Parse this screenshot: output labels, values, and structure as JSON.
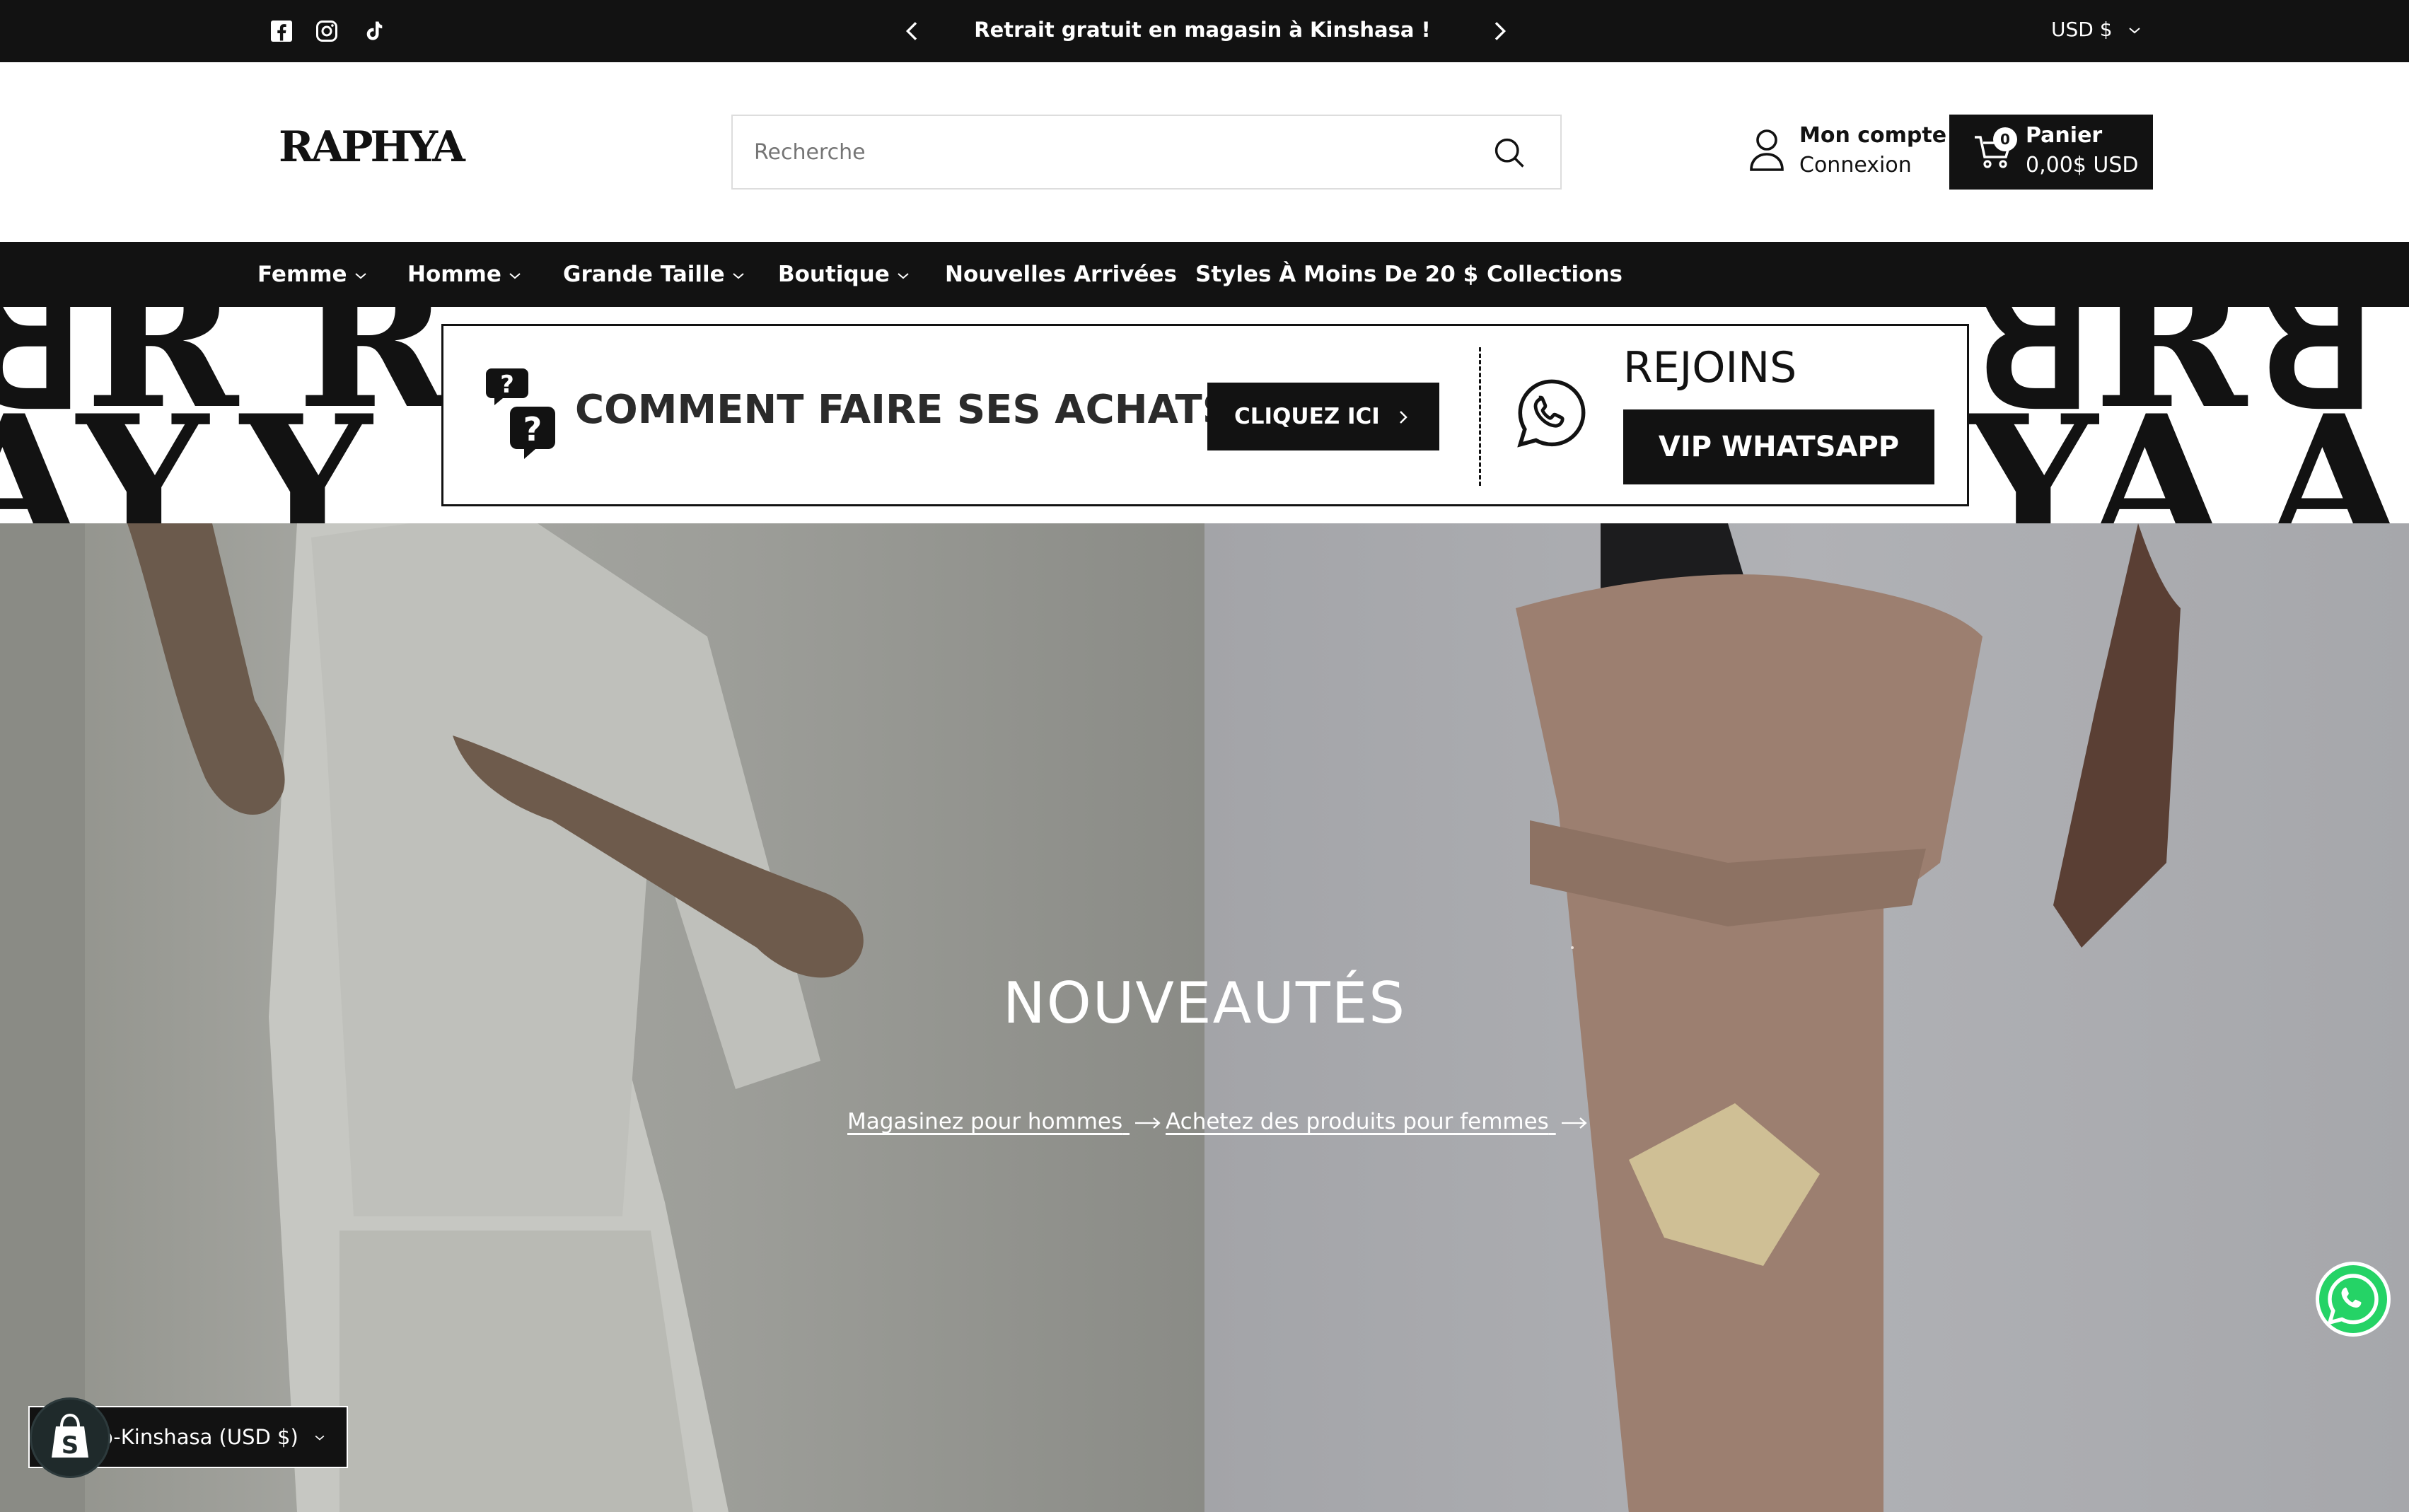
{
  "announcement": {
    "social": [
      "facebook-icon",
      "instagram-icon",
      "tiktok-icon"
    ],
    "message": "Retrait gratuit en magasin à Kinshasa !",
    "currency": "USD $"
  },
  "header": {
    "logo": "RAPHYA",
    "search_placeholder": "Recherche",
    "account_title": "Mon compte",
    "account_sub": "Connexion",
    "cart_count": "0",
    "cart_title": "Panier",
    "cart_total": "0,00$ USD"
  },
  "nav": {
    "items": [
      {
        "label": "Femme"
      },
      {
        "label": "Homme"
      },
      {
        "label": "Grande Taille"
      },
      {
        "label": "Boutique"
      },
      {
        "label": "Nouvelles Arrivées"
      },
      {
        "label": "Styles À Moins De 20 $"
      },
      {
        "label": "Collections"
      }
    ]
  },
  "promo": {
    "title": "COMMENT FAIRE SES ACHATS ?",
    "button": "CLIQUEZ ICI",
    "join": "REJOINS",
    "vip_button": "VIP WHATSAPP"
  },
  "hero": {
    "title": "NOUVEAUTÉS",
    "link_men": "Magasinez pour hommes",
    "link_women": "Achetez des produits pour femmes"
  },
  "locale": {
    "label": "o-Kinshasa (USD $)"
  },
  "colors": {
    "dark": "#121212",
    "whatsapp": "#25d366"
  }
}
